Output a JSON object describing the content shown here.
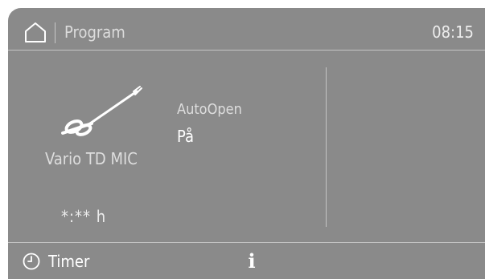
{
  "header": {
    "title": "Program",
    "time": "08:15",
    "home_icon": "home-icon"
  },
  "program": {
    "name": "Vario TD MIC",
    "duration": "*:** h",
    "icon": "instrument-icon"
  },
  "option": {
    "label": "AutoOpen",
    "value": "På"
  },
  "footer": {
    "timer_label": "Timer",
    "timer_icon": "clock-icon",
    "info_icon": "info-icon",
    "info_glyph": "i"
  },
  "colors": {
    "screen_background": "#8a8a8a",
    "separator": "#c4c4c4",
    "text": "#ffffff"
  }
}
